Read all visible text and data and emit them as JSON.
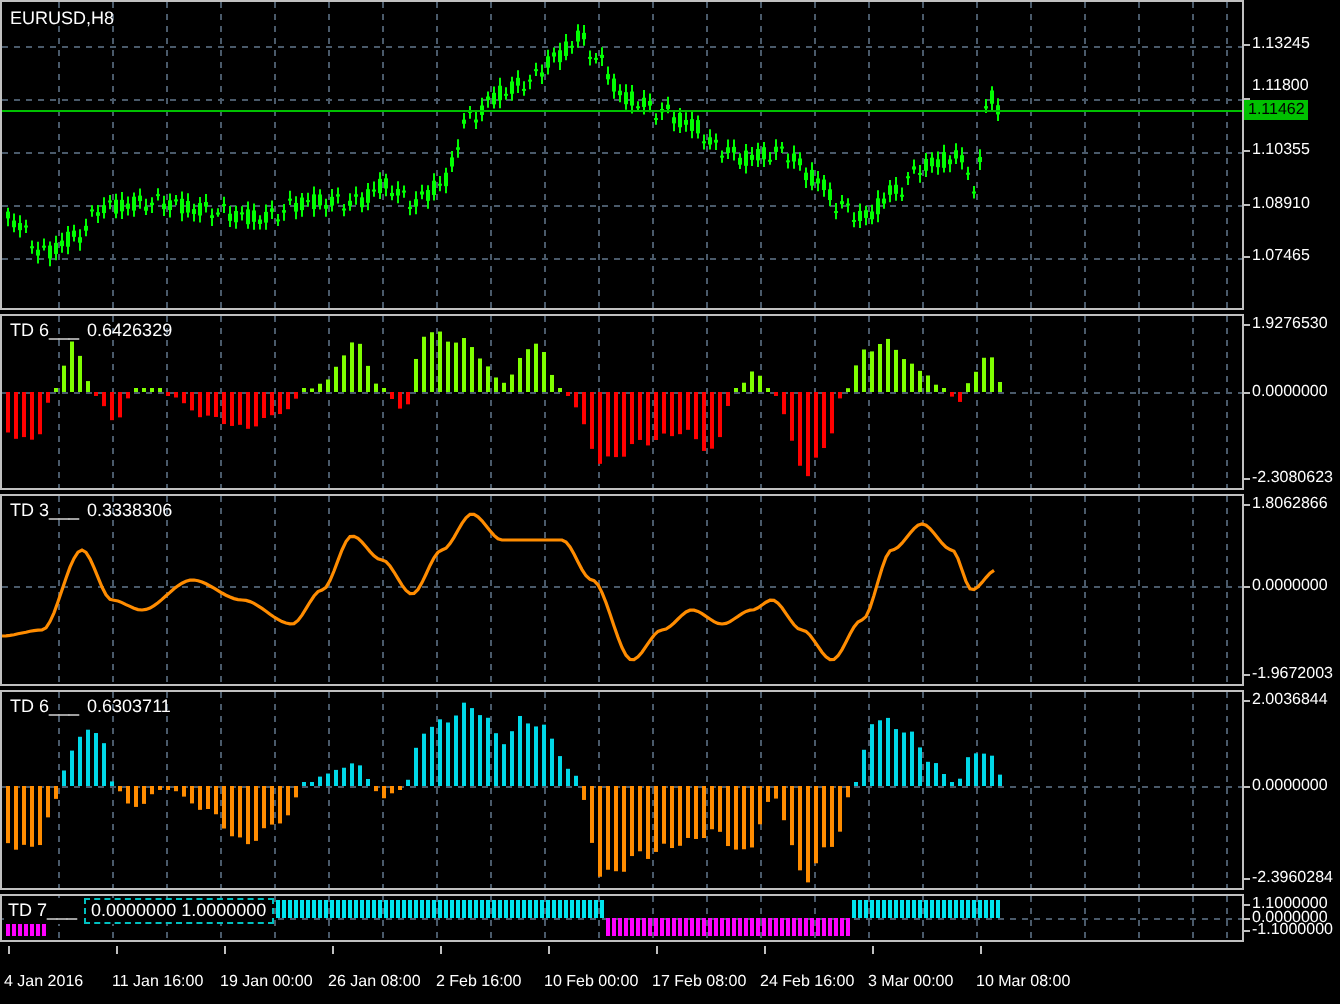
{
  "chart": {
    "symbol_label": "EURUSD,H8",
    "price_axis": [
      "1.13245",
      "1.11800",
      "1.10355",
      "1.08910",
      "1.07465"
    ],
    "bid_tag": "1.11462"
  },
  "indicators": [
    {
      "kind": "histogram",
      "name": "TD 6___",
      "values": [
        "0.6426329"
      ],
      "axis": [
        "1.9276530",
        "0.0000000",
        "-2.3080623"
      ]
    },
    {
      "kind": "line",
      "name": "TD 3___",
      "values": [
        "0.3338306"
      ],
      "axis": [
        "1.8062866",
        "0.0000000",
        "-1.9672003"
      ]
    },
    {
      "kind": "histogram",
      "name": "TD 6___",
      "values": [
        "0.6303711"
      ],
      "axis": [
        "2.0036844",
        "0.0000000",
        "-2.3960284"
      ]
    },
    {
      "kind": "signal",
      "name": "TD 7___",
      "values": [
        "0.0000000",
        "1.0000000"
      ],
      "axis": [
        "1.1000000",
        "0.0000000",
        "-1.1000000"
      ]
    }
  ],
  "time_axis": [
    "4 Jan 2016",
    "11 Jan 16:00",
    "19 Jan 00:00",
    "26 Jan 08:00",
    "2 Feb 16:00",
    "10 Feb 00:00",
    "17 Feb 08:00",
    "24 Feb 16:00",
    "3 Mar 00:00",
    "10 Mar 08:00"
  ]
}
